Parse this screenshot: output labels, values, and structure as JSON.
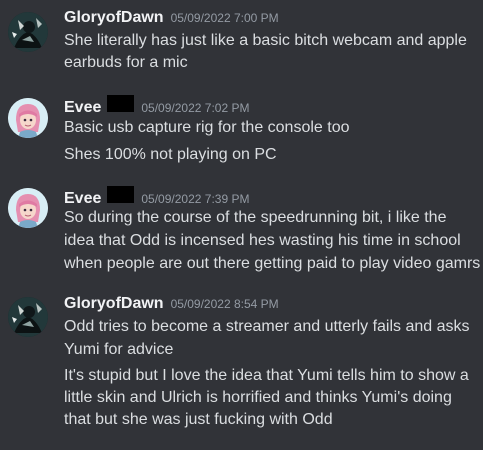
{
  "messages": [
    {
      "username": "GloryofDawn",
      "timestamp": "05/09/2022 7:00 PM",
      "avatar_icon": "dark-figure-avatar-icon",
      "paragraphs": [
        [
          "She literally has just like a basic bitch webcam and apple",
          "earbuds for a mic"
        ]
      ]
    },
    {
      "username": "Evee",
      "timestamp": "05/09/2022 7:02 PM",
      "avatar_icon": "pink-hair-girl-avatar-icon",
      "paragraphs": [
        [
          "Basic usb capture rig for the console too"
        ],
        [
          "Shes 100% not playing on PC"
        ]
      ]
    },
    {
      "username": "Evee",
      "timestamp": "05/09/2022 7:39 PM",
      "avatar_icon": "pink-hair-girl-avatar-icon",
      "paragraphs": [
        [
          "So during the course of the speedrunning bit, i like the",
          "idea that Odd is incensed hes wasting his time in school",
          "when people are out there getting paid to play video gamrs"
        ]
      ]
    },
    {
      "username": "GloryofDawn",
      "timestamp": "05/09/2022 8:54 PM",
      "avatar_icon": "dark-figure-avatar-icon",
      "paragraphs": [
        [
          "Odd tries to become a streamer and utterly fails and asks",
          "Yumi for advice"
        ],
        [
          "It's stupid but I love the idea that Yumi tells him to show a",
          "little skin and Ulrich is horrified and thinks Yumi's doing",
          "that but she was just fucking with Odd"
        ]
      ]
    }
  ],
  "colors": {
    "background": "#313338",
    "username": "#f2f3f5",
    "timestamp": "#949ba4",
    "text": "#dbdee1",
    "redaction": "#000000"
  }
}
